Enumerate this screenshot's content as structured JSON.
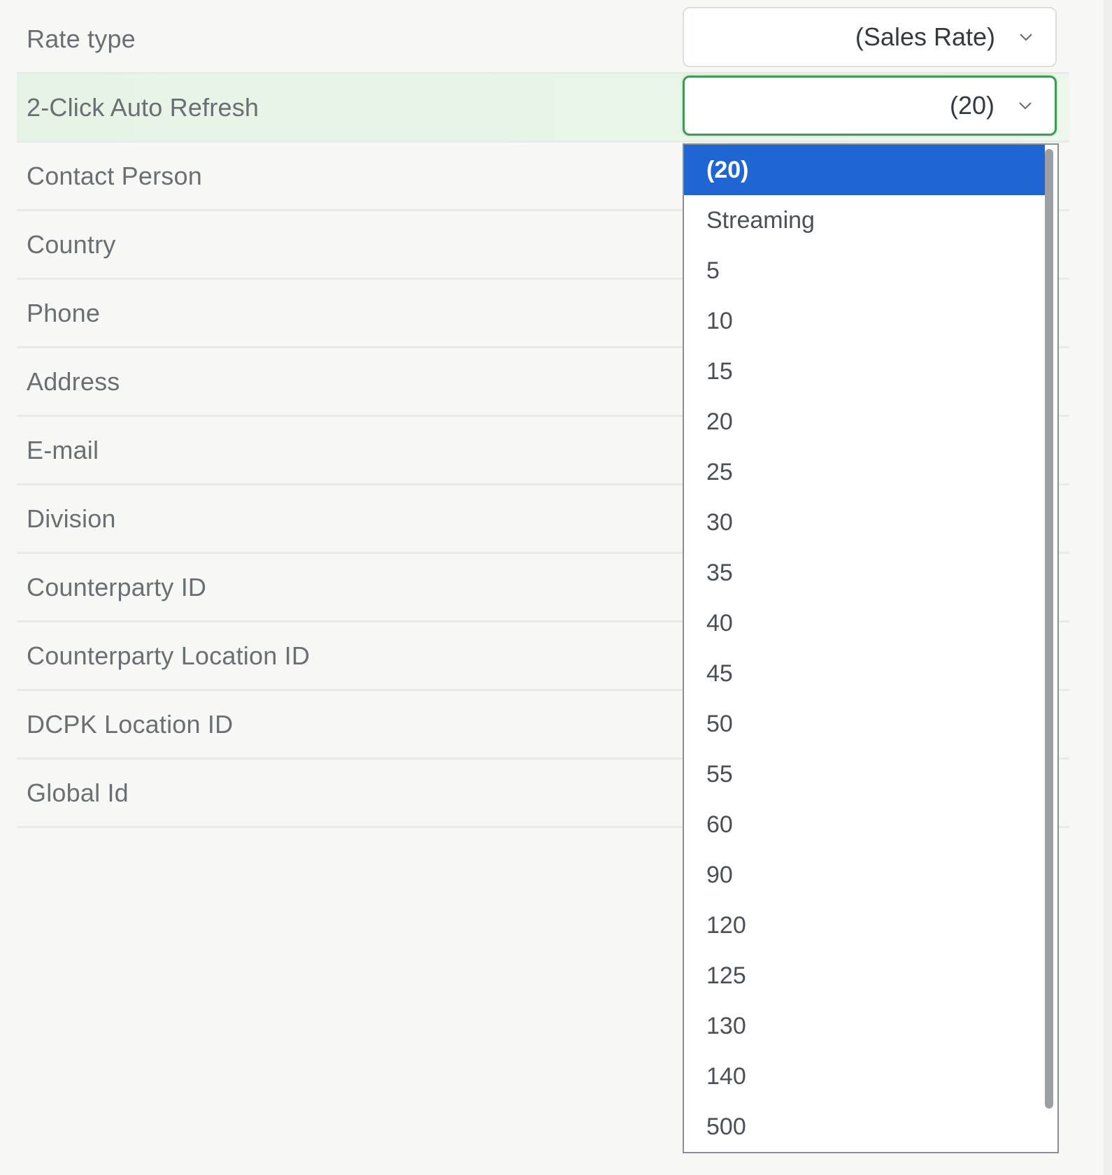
{
  "form": {
    "rows": [
      {
        "label": "Rate type",
        "value": "(Sales Rate)"
      },
      {
        "label": "2-Click Auto Refresh",
        "value": "(20)"
      },
      {
        "label": "Contact Person"
      },
      {
        "label": "Country"
      },
      {
        "label": "Phone"
      },
      {
        "label": "Address"
      },
      {
        "label": "E-mail"
      },
      {
        "label": "Division"
      },
      {
        "label": "Counterparty ID"
      },
      {
        "label": "Counterparty Location ID"
      },
      {
        "label": "DCPK Location ID"
      },
      {
        "label": "Global Id"
      }
    ]
  },
  "dropdown": {
    "selected": "(20)",
    "options": [
      "(20)",
      "Streaming",
      "5",
      "10",
      "15",
      "20",
      "25",
      "30",
      "35",
      "40",
      "45",
      "50",
      "55",
      "60",
      "90",
      "120",
      "125",
      "130",
      "140",
      "500"
    ]
  },
  "colors": {
    "highlight_row": "#e6f3e6",
    "focus_border": "#3f9a55",
    "selected_option": "#1f66d4",
    "label_text": "#6a6f73"
  },
  "icons": {
    "select_chevron": "chevron-down-icon"
  }
}
